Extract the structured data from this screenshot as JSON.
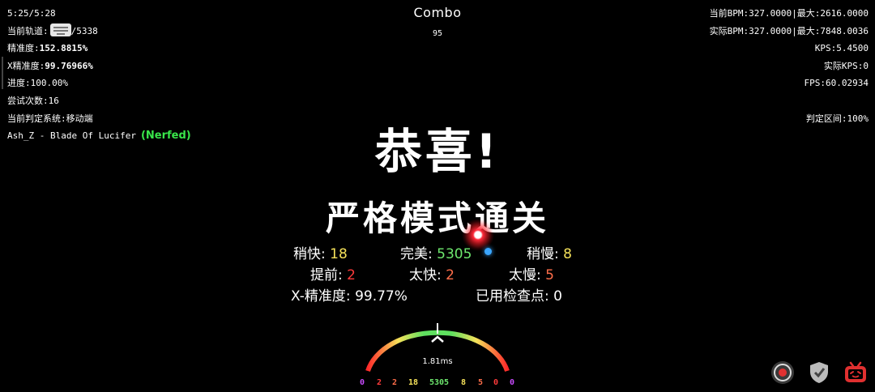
{
  "hud_left": {
    "time": "5:25/5:28",
    "track_label": "当前轨道:",
    "track_value": "/5338",
    "precision_label": "精准度:",
    "precision_value": "152.8815%",
    "xprecision_label": "X精准度:",
    "xprecision_value": "99.76966%",
    "progress": "进度:100.00%",
    "attempts": "尝试次数:16",
    "judge_system": "当前判定系统:移动端",
    "song": "Ash_Z - Blade Of Lucifer",
    "nerfed": "(Nerfed)"
  },
  "hud_right": {
    "bpm": "当前BPM:327.0000|最大:2616.0000",
    "real_bpm": "实际BPM:327.0000|最大:7848.0036",
    "kps": "KPS:5.4500",
    "real_kps": "实际KPS:0",
    "fps": "FPS:60.02934",
    "judge_range": "判定区间:100%"
  },
  "combo": {
    "title": "Combo",
    "value": "95"
  },
  "result": {
    "congrats": "恭喜!",
    "strict_clear": "严格模式通关"
  },
  "stats": {
    "slightly_early_label": "稍快:",
    "slightly_early_value": "18",
    "perfect_label": "完美:",
    "perfect_value": "5305",
    "slightly_late_label": "稍慢:",
    "slightly_late_value": "8",
    "early_label": "提前:",
    "early_value": "2",
    "too_early_label": "太快:",
    "too_early_value": "2",
    "too_late_label": "太慢:",
    "too_late_value": "5",
    "xacc_label": "X-精准度:",
    "xacc_value": "99.77%",
    "checkpoints_label": "已用检查点:",
    "checkpoints_value": "0"
  },
  "gauge": {
    "offset": "1.81ms"
  },
  "judge_counts": [
    "0",
    "2",
    "2",
    "18",
    "5305",
    "8",
    "5",
    "0",
    "0"
  ],
  "colors": {
    "yellow": "#f5e15a",
    "green": "#6ee86e",
    "red": "#ff3b3b",
    "purple": "#c94cff",
    "nerfed": "#39e64a"
  },
  "icons": [
    "record-icon",
    "shield-icon",
    "bilibili-tv-icon"
  ]
}
